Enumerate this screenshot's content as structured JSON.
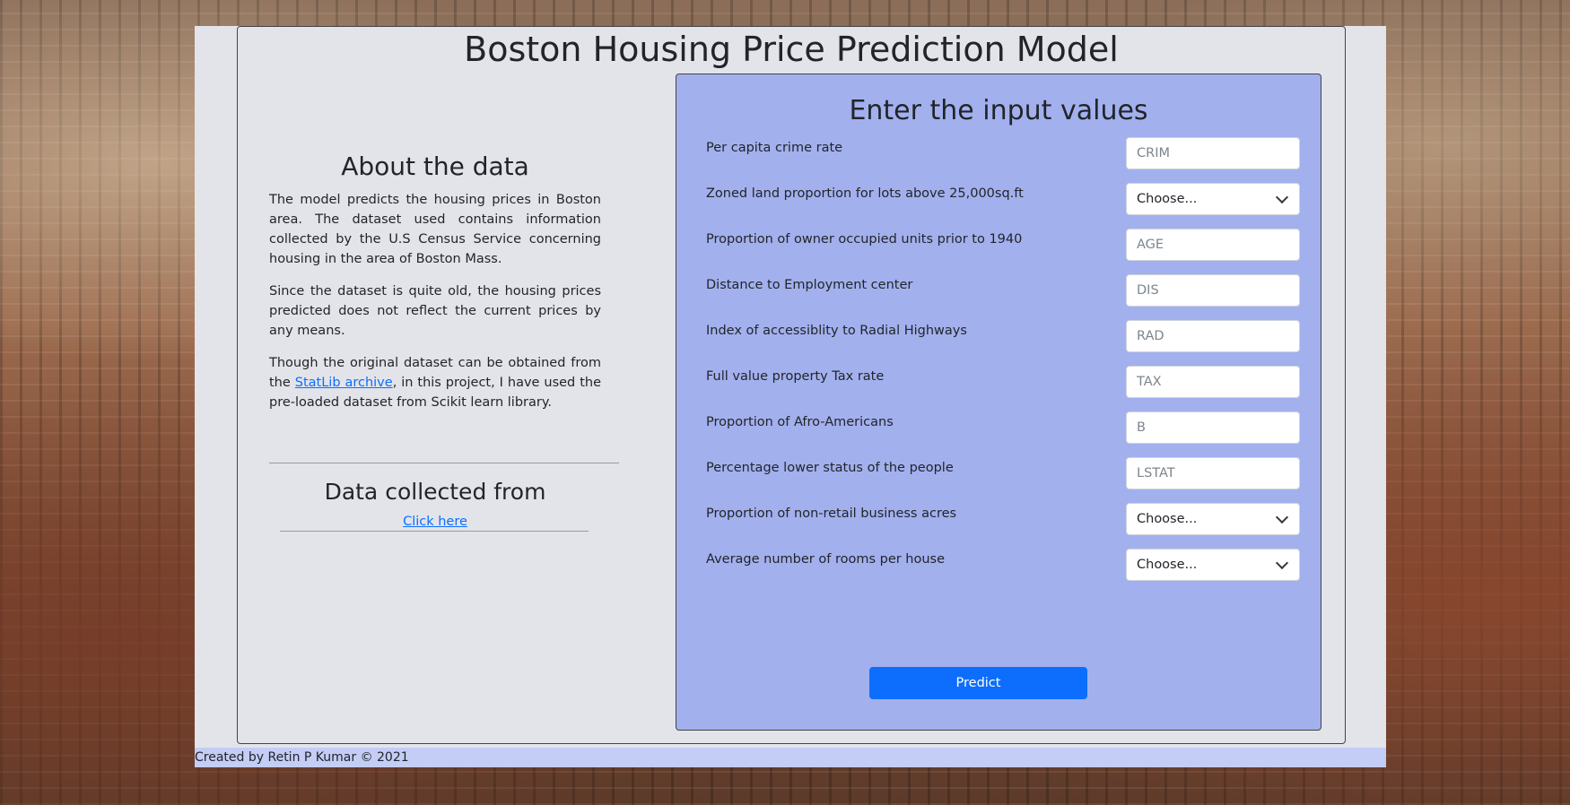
{
  "header": {
    "title": "Boston Housing Price Prediction Model"
  },
  "about": {
    "heading": "About the data",
    "p1": "The model predicts the housing prices in Boston area. The dataset used contains information collected by the U.S Census Service concerning housing in the area of Boston Mass.",
    "p2": "Since the dataset is quite old, the housing prices predicted does not reflect the current prices by any means.",
    "p3_before": "Though the original dataset can be obtained from the ",
    "p3_link": "StatLib archive",
    "p3_after": ", in this project, I have used the pre-loaded dataset from Scikit learn library."
  },
  "source": {
    "heading": "Data collected from",
    "link": "Click here"
  },
  "form": {
    "heading": "Enter the input values",
    "fields": [
      {
        "label": "Per capita crime rate",
        "type": "input",
        "placeholder": "CRIM",
        "value": ""
      },
      {
        "label": "Zoned land proportion for lots above 25,000sq.ft",
        "type": "select",
        "selected": "Choose..."
      },
      {
        "label": "Proportion of owner occupied units prior to 1940",
        "type": "input",
        "placeholder": "AGE",
        "value": ""
      },
      {
        "label": "Distance to Employment center",
        "type": "input",
        "placeholder": "DIS",
        "value": ""
      },
      {
        "label": "Index of accessiblity to Radial Highways",
        "type": "input",
        "placeholder": "RAD",
        "value": ""
      },
      {
        "label": "Full value property Tax rate",
        "type": "input",
        "placeholder": "TAX",
        "value": ""
      },
      {
        "label": "Proportion of Afro-Americans",
        "type": "input",
        "placeholder": "B",
        "value": ""
      },
      {
        "label": "Percentage lower status of the people",
        "type": "input",
        "placeholder": "LSTAT",
        "value": ""
      },
      {
        "label": "Proportion of non-retail business acres",
        "type": "select",
        "selected": "Choose..."
      },
      {
        "label": "Average number of rooms per house",
        "type": "select",
        "selected": "Choose..."
      }
    ],
    "submit_label": "Predict"
  },
  "footer": {
    "text": "Created by Retin P Kumar © 2021"
  },
  "colors": {
    "panel": "#a3b0ee",
    "page": "#e3e4ea",
    "button": "#0d6efd",
    "footer": "#c3cdf6"
  }
}
